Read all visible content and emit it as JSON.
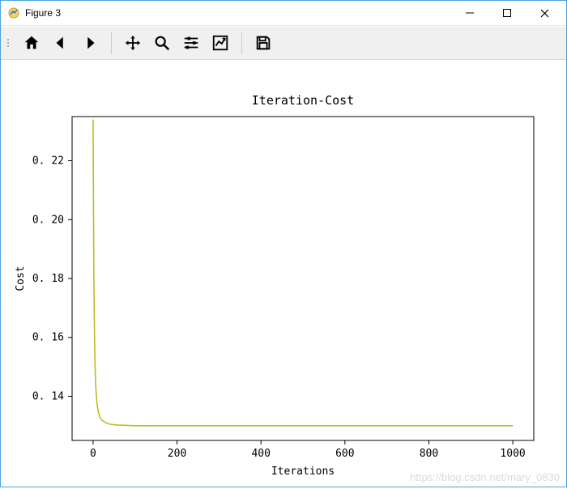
{
  "window": {
    "title": "Figure 3"
  },
  "toolbar_icons": {
    "home": "home-icon",
    "back": "back-icon",
    "forward": "forward-icon",
    "pan": "pan-icon",
    "zoom": "zoom-icon",
    "config": "config-icon",
    "axes": "axes-icon",
    "save": "save-icon"
  },
  "chart_data": {
    "type": "line",
    "title": "Iteration-Cost",
    "xlabel": "Iterations",
    "ylabel": "Cost",
    "xlim": [
      -50,
      1050
    ],
    "ylim": [
      0.125,
      0.235
    ],
    "x_ticks": [
      0,
      200,
      400,
      600,
      800,
      1000
    ],
    "y_ticks": [
      0.14,
      0.16,
      0.18,
      0.2,
      0.22
    ],
    "y_tick_labels": [
      "0. 14",
      "0. 16",
      "0. 18",
      "0. 20",
      "0. 22"
    ],
    "line_color": "#bcbd22",
    "series": [
      {
        "name": "cost",
        "x": [
          0,
          1,
          2,
          3,
          4,
          5,
          6,
          7,
          8,
          9,
          10,
          12,
          14,
          16,
          18,
          20,
          25,
          30,
          40,
          60,
          100,
          200,
          400,
          600,
          800,
          1000
        ],
        "y": [
          0.234,
          0.205,
          0.18,
          0.165,
          0.155,
          0.149,
          0.145,
          0.142,
          0.14,
          0.138,
          0.137,
          0.135,
          0.134,
          0.133,
          0.1325,
          0.132,
          0.1315,
          0.131,
          0.1305,
          0.1302,
          0.13,
          0.13,
          0.13,
          0.13,
          0.13,
          0.13
        ]
      }
    ]
  },
  "watermark": "https://blog.csdn.net/mary_0830"
}
